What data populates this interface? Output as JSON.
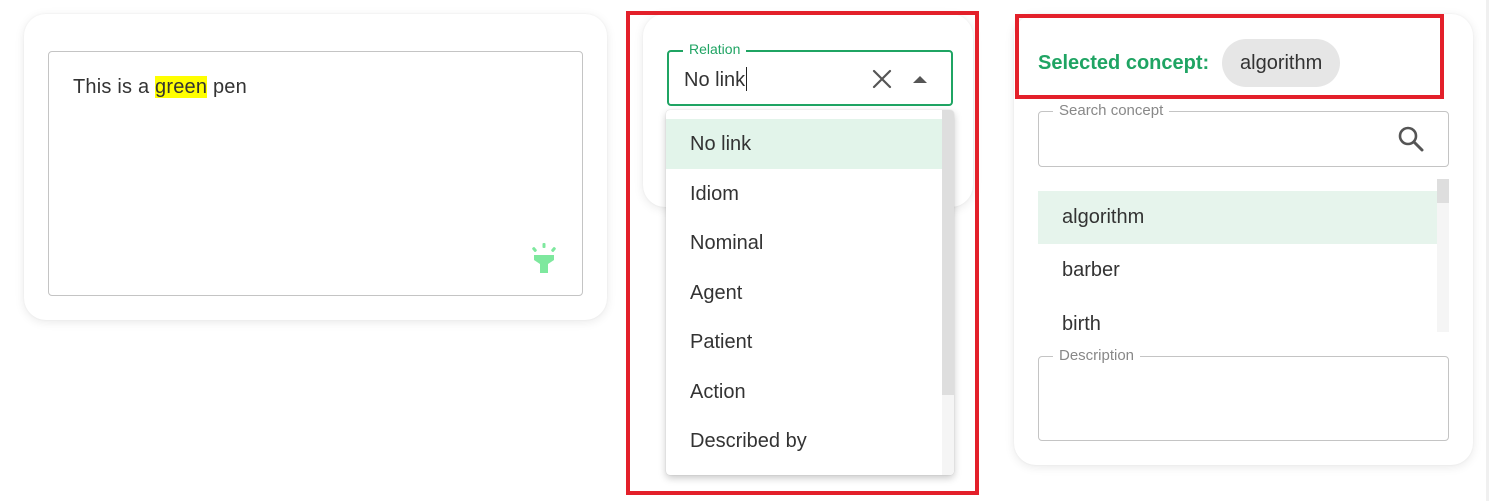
{
  "sentence": {
    "before": "This is a ",
    "highlight": "green",
    "after": " pen"
  },
  "relation": {
    "legend": "Relation",
    "value": "No link",
    "options": [
      {
        "label": "No link",
        "selected": true
      },
      {
        "label": "Idiom",
        "selected": false
      },
      {
        "label": "Nominal",
        "selected": false
      },
      {
        "label": "Agent",
        "selected": false
      },
      {
        "label": "Patient",
        "selected": false
      },
      {
        "label": "Action",
        "selected": false
      },
      {
        "label": "Described by",
        "selected": false
      }
    ]
  },
  "concept_panel": {
    "selected_label": "Selected concept:",
    "selected_value": "algorithm",
    "search_legend": "Search concept",
    "search_value": "",
    "concepts": [
      "algorithm",
      "barber",
      "birth"
    ],
    "description_legend": "Description",
    "description_value": ""
  },
  "colors": {
    "accent_green": "#1fa463",
    "highlight_yellow": "#ffff00",
    "annotation_red": "#e3202a",
    "hint_icon_green": "#7ee89e"
  },
  "icons": {
    "hint": "lightbulb-hint-icon",
    "clear": "close-icon",
    "open": "caret-up-icon",
    "search": "search-icon"
  }
}
